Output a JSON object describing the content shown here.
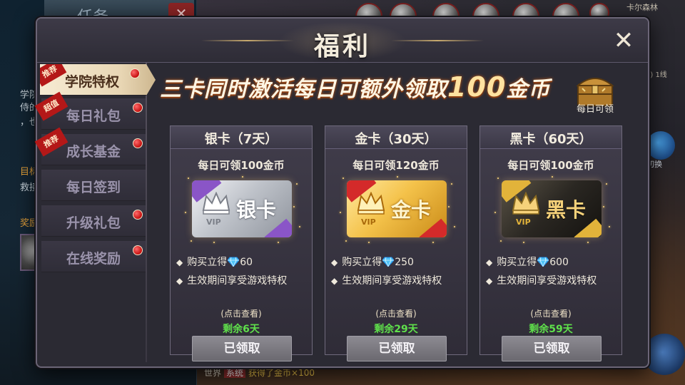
{
  "background": {
    "task_panel_title": "任务",
    "task_close": "✕",
    "task_text_1": "学院",
    "task_text_2": "侍的",
    "task_text_3": "，也",
    "goal_label": "目标",
    "goal_text": "救接",
    "reward_label": "奖励",
    "location": "卡尔森林",
    "line_info": "4) 1线",
    "switch_label": "切换",
    "chat_channel": "世界",
    "chat_sys": "系统",
    "chat_text": "获得了金币×100"
  },
  "dialog": {
    "title": "福利",
    "close_icon": "close-x"
  },
  "sidebar": {
    "items": [
      {
        "label": "学院特权",
        "ribbon": "推荐",
        "active": true,
        "red_dot": true
      },
      {
        "label": "每日礼包",
        "ribbon": "超值",
        "active": false,
        "red_dot": true
      },
      {
        "label": "成长基金",
        "ribbon": "推荐",
        "active": false,
        "red_dot": true
      },
      {
        "label": "每日签到",
        "ribbon": "",
        "active": false,
        "red_dot": false
      },
      {
        "label": "升级礼包",
        "ribbon": "",
        "active": false,
        "red_dot": true
      },
      {
        "label": "在线奖励",
        "ribbon": "",
        "active": false,
        "red_dot": true
      }
    ]
  },
  "banner": {
    "text_before": "三卡同时激活每日可额外领取",
    "amount": "100",
    "text_after": "金币",
    "chest_label": "每日可领"
  },
  "cards": [
    {
      "type": "silver",
      "title": "银卡（7天）",
      "daily": "每日可领100金币",
      "vip_tag": "VIP",
      "card_name": "银卡",
      "perk1_prefix": "购买立得",
      "perk1_amount": "60",
      "perk2": "生效期间享受游戏特权",
      "detail": "(点击查看)",
      "remaining": "剩余6天",
      "button": "已领取"
    },
    {
      "type": "gold",
      "title": "金卡（30天）",
      "daily": "每日可领120金币",
      "vip_tag": "VIP",
      "card_name": "金卡",
      "perk1_prefix": "购买立得",
      "perk1_amount": "250",
      "perk2": "生效期间享受游戏特权",
      "detail": "(点击查看)",
      "remaining": "剩余29天",
      "button": "已领取"
    },
    {
      "type": "black",
      "title": "黑卡（60天）",
      "daily": "每日可领100金币",
      "vip_tag": "VIP",
      "card_name": "黑卡",
      "perk1_prefix": "购买立得",
      "perk1_amount": "600",
      "perk2": "生效期间享受游戏特权",
      "detail": "(点击查看)",
      "remaining": "剩余59天",
      "button": "已领取"
    }
  ],
  "colors": {
    "remaining_green": "#5fe04b",
    "ribbon_red": "#b41818",
    "active_tab": "#f6ebd3"
  }
}
